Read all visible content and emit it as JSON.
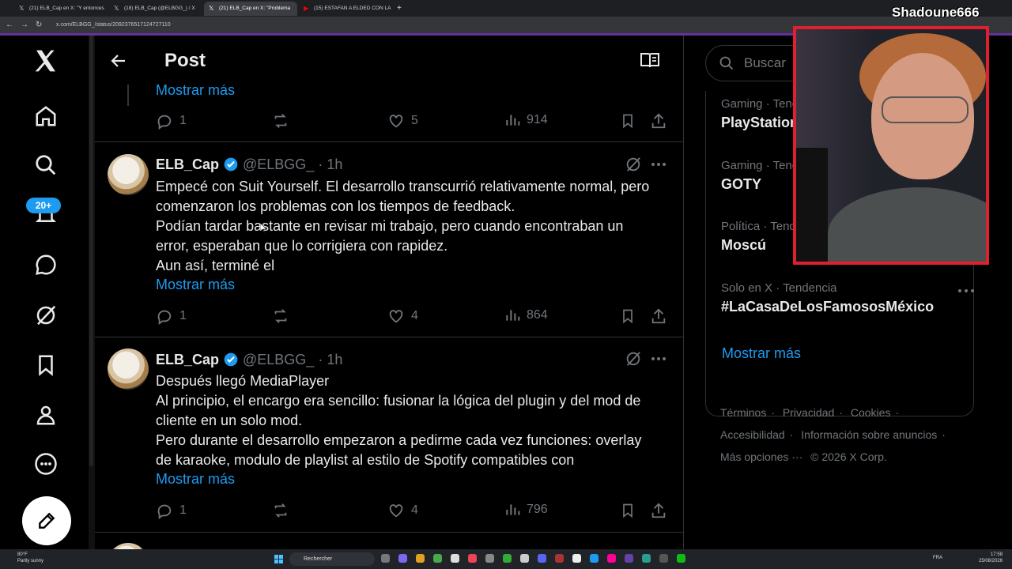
{
  "browser": {
    "tabs": [
      {
        "label": "(21) ELB_Cap en X: \"Y entonces",
        "favicon": "x-logo-icon"
      },
      {
        "label": "(18) ELB_Cap (@ELBGG_) / X",
        "favicon": "x-logo-icon"
      },
      {
        "label": "(21) ELB_Cap en X: \"Problema",
        "favicon": "x-logo-icon"
      },
      {
        "label": "(15) ESTAFAN A ELDED CON LA",
        "favicon": "youtube-icon"
      }
    ],
    "url": "x.com/ELBGG_/status/2092376517124727110"
  },
  "streamer": {
    "name": "Shadoune666"
  },
  "header": {
    "title": "Post"
  },
  "sidebar": {
    "notification_badge": "20+"
  },
  "top_tweet": {
    "show_more": "Mostrar más",
    "replies": "1",
    "likes": "5",
    "views": "914"
  },
  "tweets": [
    {
      "name": "ELB_Cap",
      "handle": "@ELBGG_",
      "time": "· 1h",
      "lines": [
        "Empecé con Suit Yourself. El desarrollo transcurrió relativamente normal, pero",
        "comenzaron los problemas con los tiempos de feedback.",
        "Podían tardar bastante en revisar mi trabajo, pero cuando encontraban un",
        "error, esperaban que lo corrigiera con rapidez.",
        "Aun así, terminé el"
      ],
      "show_more": "Mostrar más",
      "replies": "1",
      "likes": "4",
      "views": "864"
    },
    {
      "name": "ELB_Cap",
      "handle": "@ELBGG_",
      "time": "· 1h",
      "lines": [
        "Después llegó MediaPlayer",
        "Al principio, el encargo era sencillo: fusionar la lógica del plugin y del mod de",
        "cliente en un solo mod.",
        "Pero durante el desarrollo empezaron a pedirme cada vez funciones: overlay",
        "de karaoke, modulo de playlist al estilo de Spotify compatibles con"
      ],
      "show_more": "Mostrar más",
      "replies": "1",
      "likes": "4",
      "views": "796"
    }
  ],
  "search": {
    "placeholder": "Buscar"
  },
  "trends": [
    {
      "context": "Gaming · Tendencia",
      "title": "PlayStation"
    },
    {
      "context": "Gaming · Tendencia",
      "title": "GOTY"
    },
    {
      "context": "Política · Tendencia",
      "title": "Moscú"
    },
    {
      "context": "Solo en X · Tendencia",
      "title": "#LaCasaDeLosFamososMéxico"
    }
  ],
  "trends_show_more": "Mostrar más",
  "footer": {
    "links": [
      "Términos",
      "Privacidad",
      "Cookies",
      "Accesibilidad",
      "Información sobre anuncios",
      "Más opciones ···"
    ],
    "copyright": "© 2026 X Corp."
  },
  "taskbar": {
    "weather_temp": "80°F",
    "weather_desc": "Partly sunny",
    "search_label": "Rechercher",
    "lang": "FRA",
    "time": "17:58",
    "date": "25/08/2026"
  },
  "colors": {
    "accent": "#1d9bf0",
    "background": "#000000",
    "muted": "#71767b",
    "frame": "#e0202f"
  }
}
